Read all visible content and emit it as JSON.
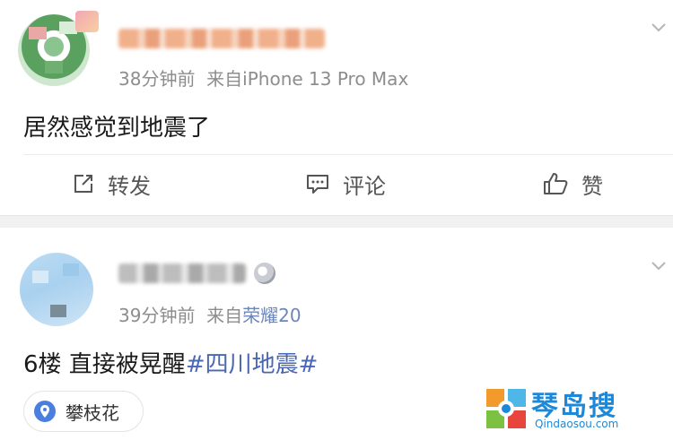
{
  "posts": [
    {
      "meta_time": "38分钟前",
      "meta_from": "来自iPhone 13 Pro Max",
      "content": "居然感觉到地震了",
      "actions": {
        "repost": "转发",
        "comment": "评论",
        "like": "赞"
      }
    },
    {
      "meta_time": "39分钟前",
      "meta_from": "来自",
      "meta_source": "荣耀20",
      "content_prefix": "6楼 直接被晃醒",
      "topic": "#四川地震#",
      "location": "攀枝花"
    }
  ],
  "watermark": {
    "title": "琴岛搜",
    "domain": "Qindaosou.com"
  },
  "colors": {
    "topic": "#4a67b3",
    "meta": "#8d8d8d",
    "watermark": "#1e88d8",
    "separator": "#f1f1f1"
  },
  "icons": [
    "chevron-down-icon",
    "repost-icon",
    "comment-icon",
    "like-icon",
    "location-pin-icon",
    "watermark-logo-icon",
    "medal-icon"
  ]
}
